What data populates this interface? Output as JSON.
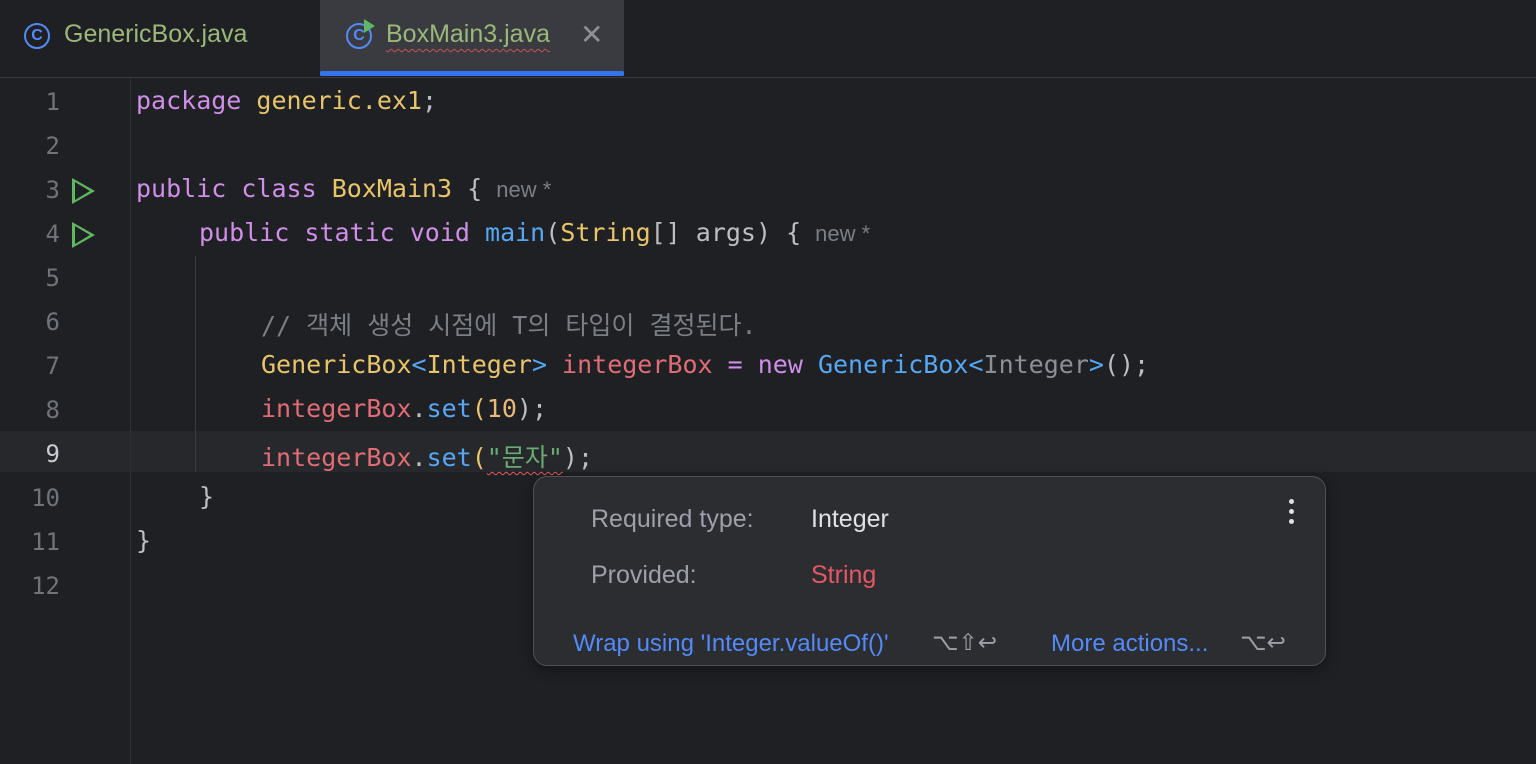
{
  "tabs": [
    {
      "label": "GenericBox.java",
      "icon": "class-icon",
      "active": false
    },
    {
      "label": "BoxMain3.java",
      "icon": "runnable-class-icon",
      "active": true,
      "close": "✕"
    }
  ],
  "editor": {
    "line_numbers": [
      "1",
      "2",
      "3",
      "4",
      "5",
      "6",
      "7",
      "8",
      "9",
      "10",
      "11",
      "12"
    ],
    "active_line": "9",
    "lines": {
      "l1": {
        "kw": "package",
        "name": "generic.ex1",
        "end": ";"
      },
      "l3": {
        "kw1": "public",
        "kw2": "class",
        "name": "BoxMain3",
        "brace": " {",
        "hint": "new *"
      },
      "l4": {
        "kw1": "public",
        "kw2": "static",
        "kw3": "void",
        "fn": "main",
        "p1": "(",
        "type": "String",
        "p2": "[] args) {",
        "hint": "new *"
      },
      "l6": {
        "comment": "// 객체 생성 시점에 T의 타입이 결정된다."
      },
      "l7": {
        "t1": "GenericBox",
        "lt": "<",
        "t2": "Integer",
        "gt": ">",
        "var": " integerBox",
        "eq": " = ",
        "kw": "new",
        "gen": " GenericBox",
        "lt2": "<",
        "t3": "Integer",
        "gt2": ">",
        "end": "();"
      },
      "l8": {
        "var": "integerBox",
        "dot": ".",
        "fn": "set",
        "p1": "(",
        "num": "10",
        "end": ");"
      },
      "l9": {
        "var": "integerBox",
        "dot": ".",
        "fn": "set",
        "p1": "(",
        "str": "\"문자\"",
        "end": ");"
      },
      "l10": {
        "brace": "}"
      },
      "l11": {
        "brace": "}"
      }
    }
  },
  "popup": {
    "required_label": "Required type:",
    "required_value": "Integer",
    "provided_label": "Provided:",
    "provided_value": "String",
    "action1": "Wrap using 'Integer.valueOf()'",
    "action1_shortcut": "⌥⇧↩",
    "action2": "More actions...",
    "action2_shortcut": "⌥↩",
    "menu_icon": "more-vertical-icon"
  }
}
